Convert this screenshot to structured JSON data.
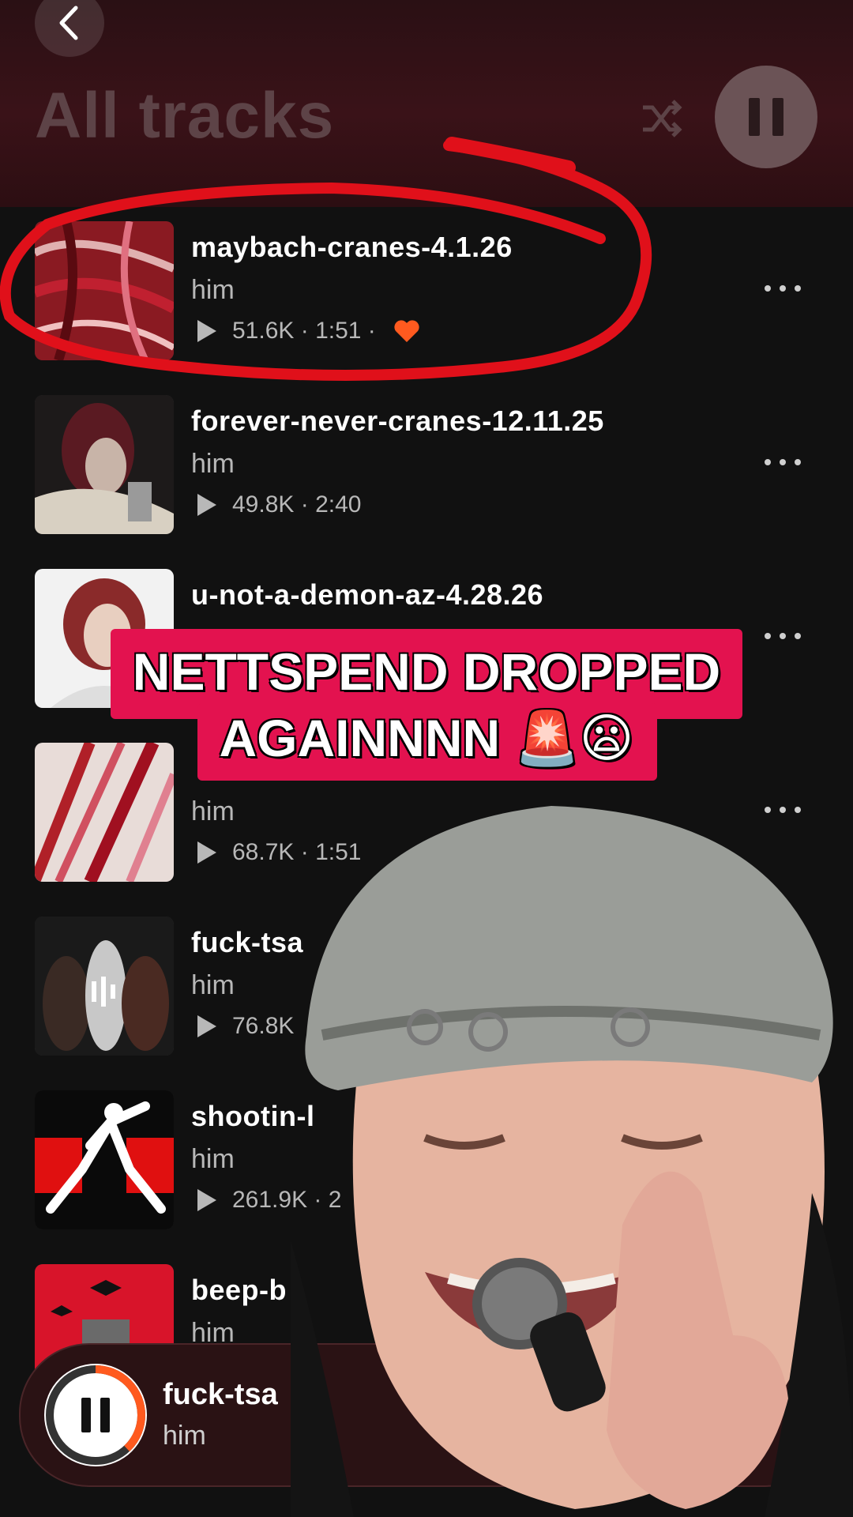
{
  "header": {
    "title": "All tracks",
    "back_icon": "chevron-left-icon",
    "shuffle_icon": "shuffle-icon",
    "pause_icon": "pause-icon"
  },
  "tracks": [
    {
      "title": "maybach-cranes-4.1.26",
      "artist": "him",
      "plays": "51.6K",
      "duration": "1:51",
      "sep": "·",
      "liked": true
    },
    {
      "title": "forever-never-cranes-12.11.25",
      "artist": "him",
      "plays": "49.8K",
      "duration": "2:40",
      "sep": "·"
    },
    {
      "title": "u-not-a-demon-az-4.28.26",
      "artist": "",
      "plays": "",
      "duration": "",
      "sep": ""
    },
    {
      "title": "",
      "artist": "him",
      "plays": "68.7K",
      "duration": "1:51",
      "sep": "·"
    },
    {
      "title": "fuck-tsa",
      "artist": "him",
      "plays": "76.8K",
      "duration": "",
      "sep": ""
    },
    {
      "title": "shootin-l",
      "artist": "him",
      "plays": "261.9K",
      "duration": "2",
      "sep": "·"
    },
    {
      "title": "beep-b",
      "artist": "him",
      "plays": "",
      "duration": "",
      "sep": ""
    }
  ],
  "caption": {
    "line1": "NETTSPEND DROPPED",
    "line2": "AGAINNNN 🚨😦"
  },
  "now_playing": {
    "title": "fuck-tsa",
    "artist": "him",
    "progress": 0.38
  },
  "colors": {
    "accent": "#e3124f",
    "heart": "#ff5a1f",
    "highlight": "#e0101a"
  }
}
